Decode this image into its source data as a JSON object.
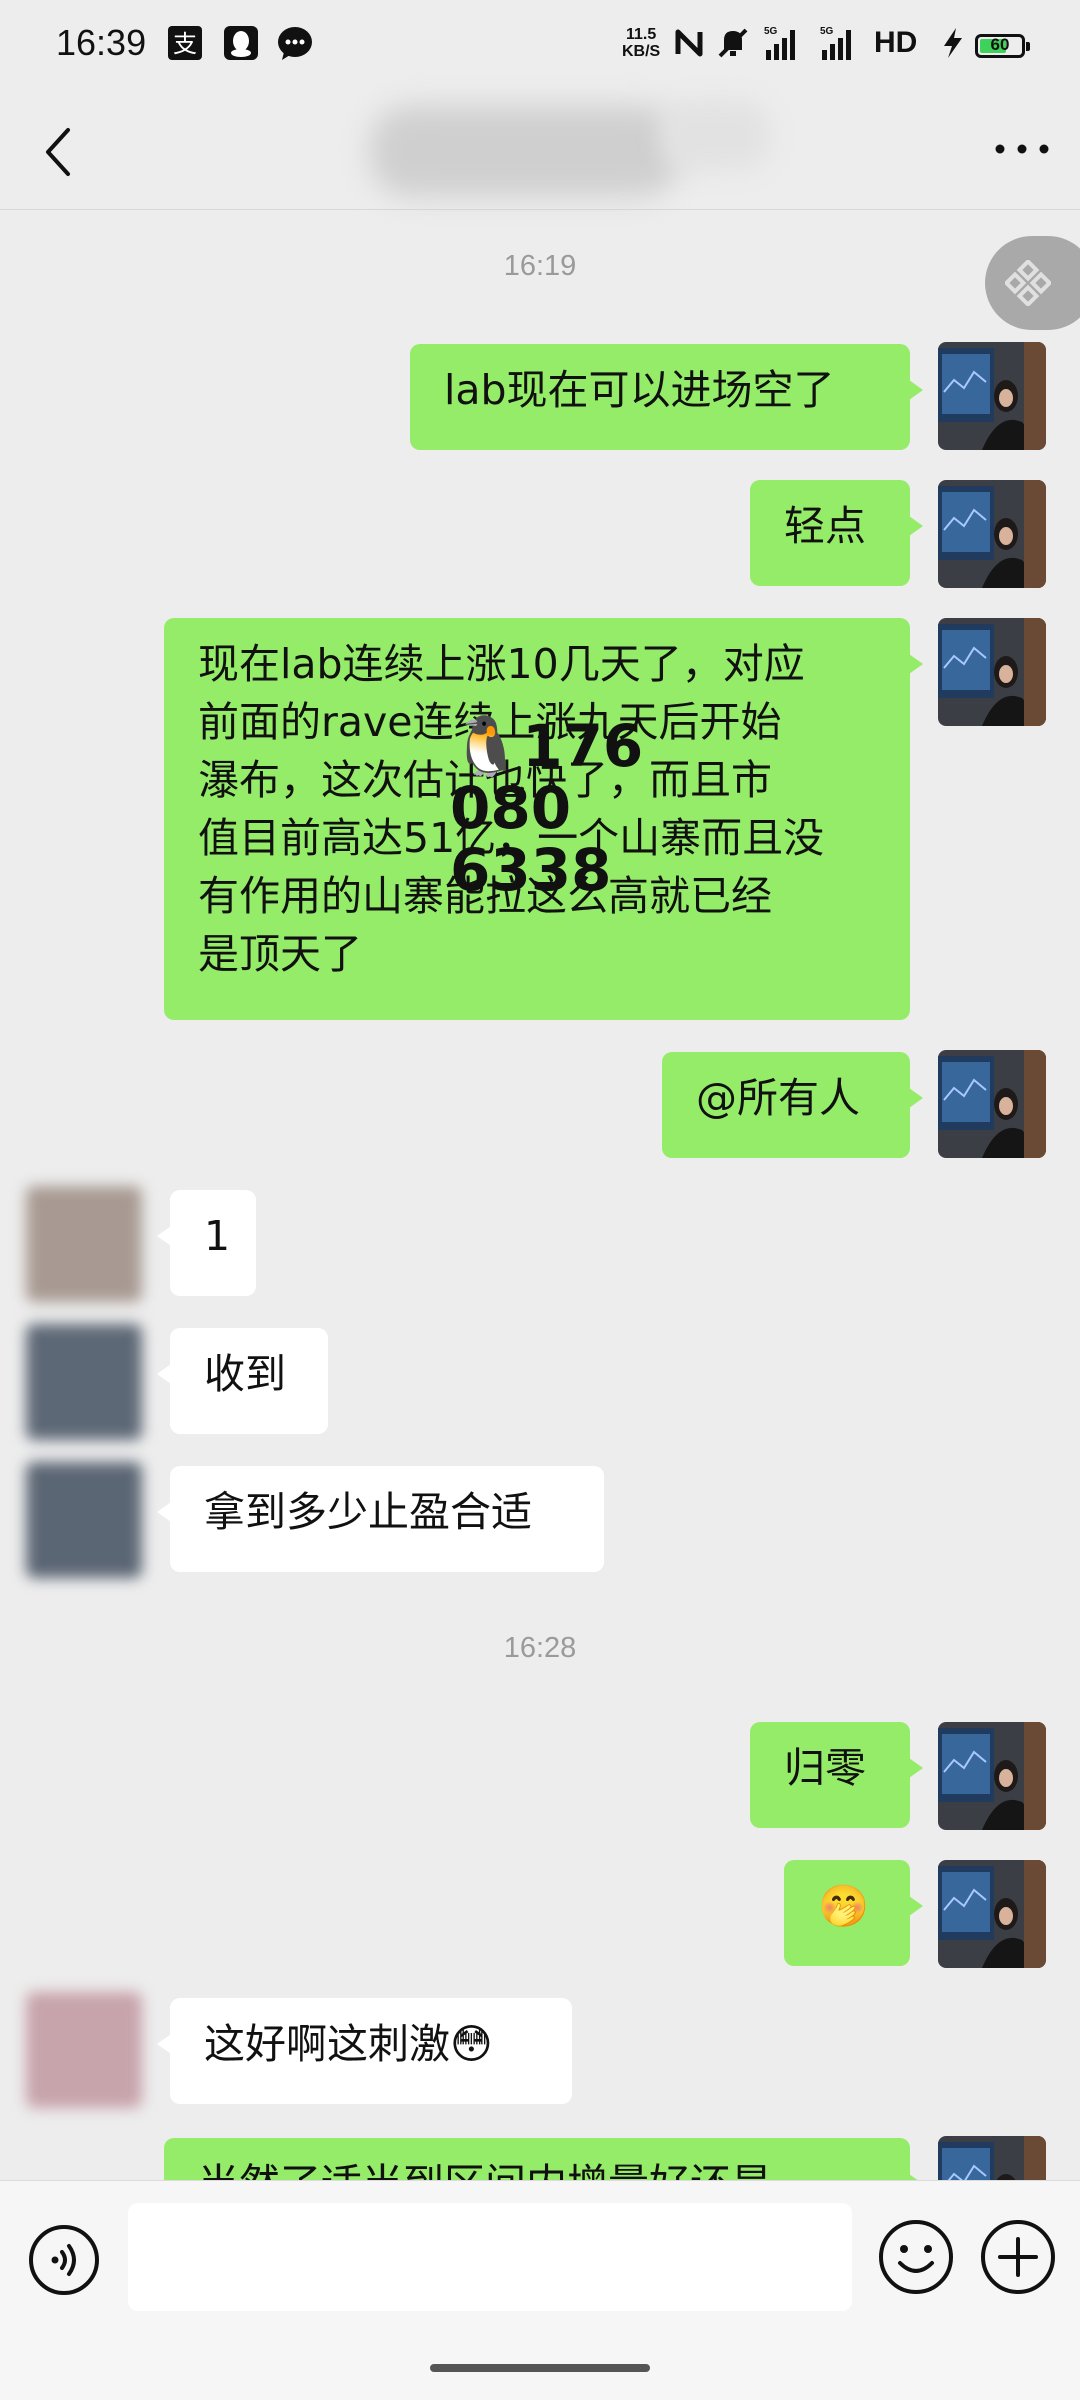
{
  "status_bar": {
    "time": "16:39",
    "net_speed_top": "11.5",
    "net_speed_bottom": "KB/S",
    "network_1": "5G",
    "network_2": "5G",
    "hd_label": "HD",
    "battery": "60",
    "icons": [
      "alipay-icon",
      "qq-icon",
      "wechat-icon",
      "nfc-icon",
      "mute-icon",
      "signal-icon",
      "signal-icon",
      "charging-icon",
      "battery-icon"
    ]
  },
  "header": {
    "back_icon": "chevron-left-icon",
    "more_icon": "more-dots-icon"
  },
  "messages": [
    {
      "type": "timestamp",
      "text": "16:19"
    },
    {
      "type": "me",
      "text": "lab现在可以进场空了"
    },
    {
      "type": "me",
      "text": "轻点"
    },
    {
      "type": "me",
      "lines": [
        "现在lab连续上涨10几天了，对应",
        "前面的rave连续上涨九天后开始",
        "瀑布，这次估计也快了，而且市",
        "值目前高达51亿，一个山寨而且没",
        "有作用的山寨能拉这么高就已经",
        "是顶天了"
      ]
    },
    {
      "type": "me",
      "text": "@所有人"
    },
    {
      "type": "other",
      "text": "1"
    },
    {
      "type": "other",
      "text": "收到"
    },
    {
      "type": "other",
      "text": "拿到多少止盈合适"
    },
    {
      "type": "timestamp",
      "text": "16:28"
    },
    {
      "type": "me",
      "text": "归零"
    },
    {
      "type": "me",
      "text": "🤭"
    },
    {
      "type": "other",
      "text": "这好啊这刺激😳"
    },
    {
      "type": "me",
      "text": "当然了适当到区间内增量好还是"
    }
  ],
  "overlay": {
    "lines": [
      "🐧176",
      "080",
      "6338"
    ]
  },
  "input_bar": {
    "voice_icon": "voice-icon",
    "emoji_icon": "emoji-icon",
    "plus_icon": "plus-icon",
    "value": ""
  },
  "colors": {
    "background": "#ededed",
    "my_bubble": "#95ec69",
    "their_bubble": "#ffffff",
    "timestamp": "#9a9a9a"
  }
}
